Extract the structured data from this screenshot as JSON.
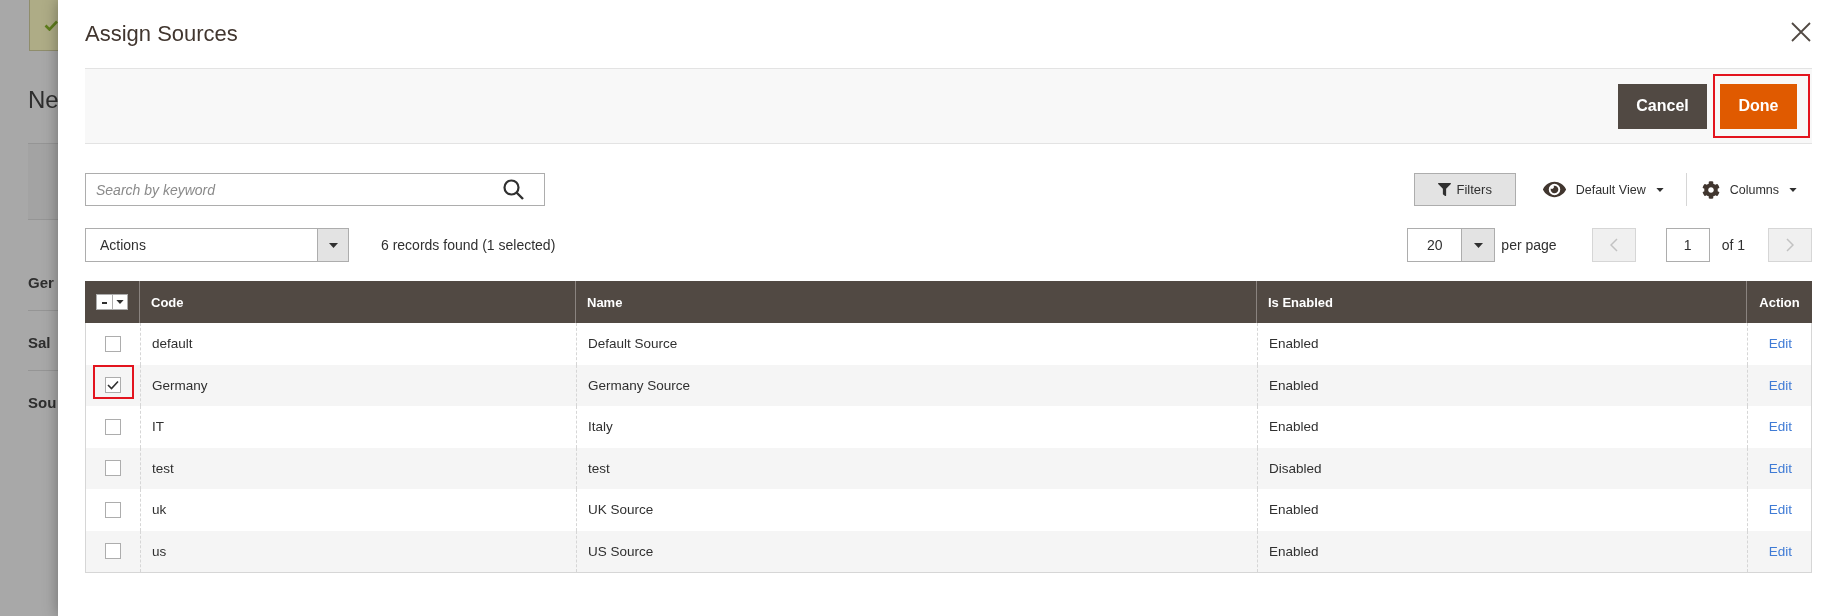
{
  "background_page": {
    "heading": "Ne",
    "sections": [
      "Ger",
      "Sal",
      "Sou"
    ]
  },
  "modal": {
    "title": "Assign Sources"
  },
  "page_actions": [
    {
      "label": "Cancel",
      "kind": "secondary",
      "highlighted": false
    },
    {
      "label": "Done",
      "kind": "primary",
      "highlighted": true
    }
  ],
  "search": {
    "placeholder": "Search by keyword"
  },
  "toolbar": {
    "filters": "Filters",
    "view": "Default View",
    "columns": "Columns"
  },
  "mass_actions": {
    "value": "Actions",
    "records_found": "6 records found (1 selected)"
  },
  "pagination": {
    "per_page": "20",
    "per_page_label": "per page",
    "prev_disabled": true,
    "page": "1",
    "of_pages": "of 1",
    "next_disabled": true
  },
  "table": {
    "select_all": {
      "indeterminate": true
    },
    "columns": [
      "Code",
      "Name",
      "Is Enabled",
      "Action"
    ],
    "rows": [
      {
        "code": "default",
        "name": "Default Source",
        "is_enabled": "Enabled",
        "action": "Edit",
        "checked": false,
        "highlighted": false
      },
      {
        "code": "Germany",
        "name": "Germany Source",
        "is_enabled": "Enabled",
        "action": "Edit",
        "checked": true,
        "highlighted": true
      },
      {
        "code": "IT",
        "name": "Italy",
        "is_enabled": "Enabled",
        "action": "Edit",
        "checked": false,
        "highlighted": false
      },
      {
        "code": "test",
        "name": "test",
        "is_enabled": "Disabled",
        "action": "Edit",
        "checked": false,
        "highlighted": false
      },
      {
        "code": "uk",
        "name": "UK Source",
        "is_enabled": "Enabled",
        "action": "Edit",
        "checked": false,
        "highlighted": false
      },
      {
        "code": "us",
        "name": "US Source",
        "is_enabled": "Enabled",
        "action": "Edit",
        "checked": false,
        "highlighted": false
      }
    ]
  }
}
